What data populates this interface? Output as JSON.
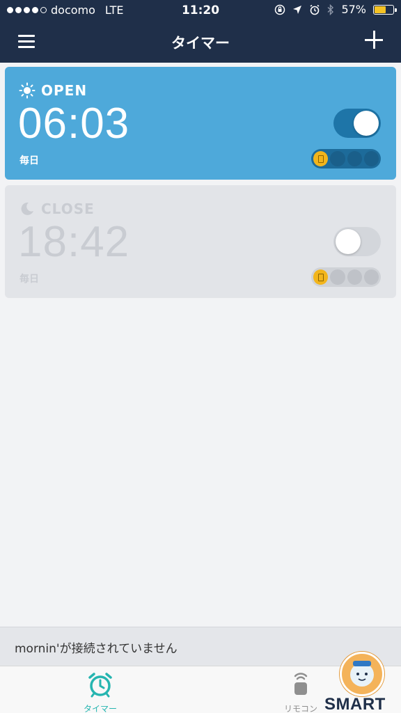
{
  "status_bar": {
    "carrier": "docomo",
    "network": "LTE",
    "time": "11:20",
    "battery": "57%",
    "battery_level": 0.57
  },
  "nav": {
    "title": "タイマー",
    "menu_icon": "hamburger-icon",
    "add_icon": "plus-icon"
  },
  "timers": [
    {
      "label": "OPEN",
      "time": "06:03",
      "repeat": "毎日",
      "enabled": true,
      "icon": "sun-icon"
    },
    {
      "label": "CLOSE",
      "time": "18:42",
      "repeat": "毎日",
      "enabled": false,
      "icon": "moon-icon"
    }
  ],
  "banner": {
    "text": "mornin'が接続されていません"
  },
  "tabs": [
    {
      "label": "タイマー",
      "icon": "alarm-clock-icon",
      "active": true
    },
    {
      "label": "リモコン",
      "icon": "remote-icon",
      "active": false
    }
  ],
  "watermark": {
    "text": "SMART"
  },
  "colors": {
    "nav_bg": "#1f2f49",
    "open_card": "#4ea9da",
    "close_card": "#e2e4e8",
    "accent": "#26b5b0",
    "device_active": "#f2b51c"
  }
}
